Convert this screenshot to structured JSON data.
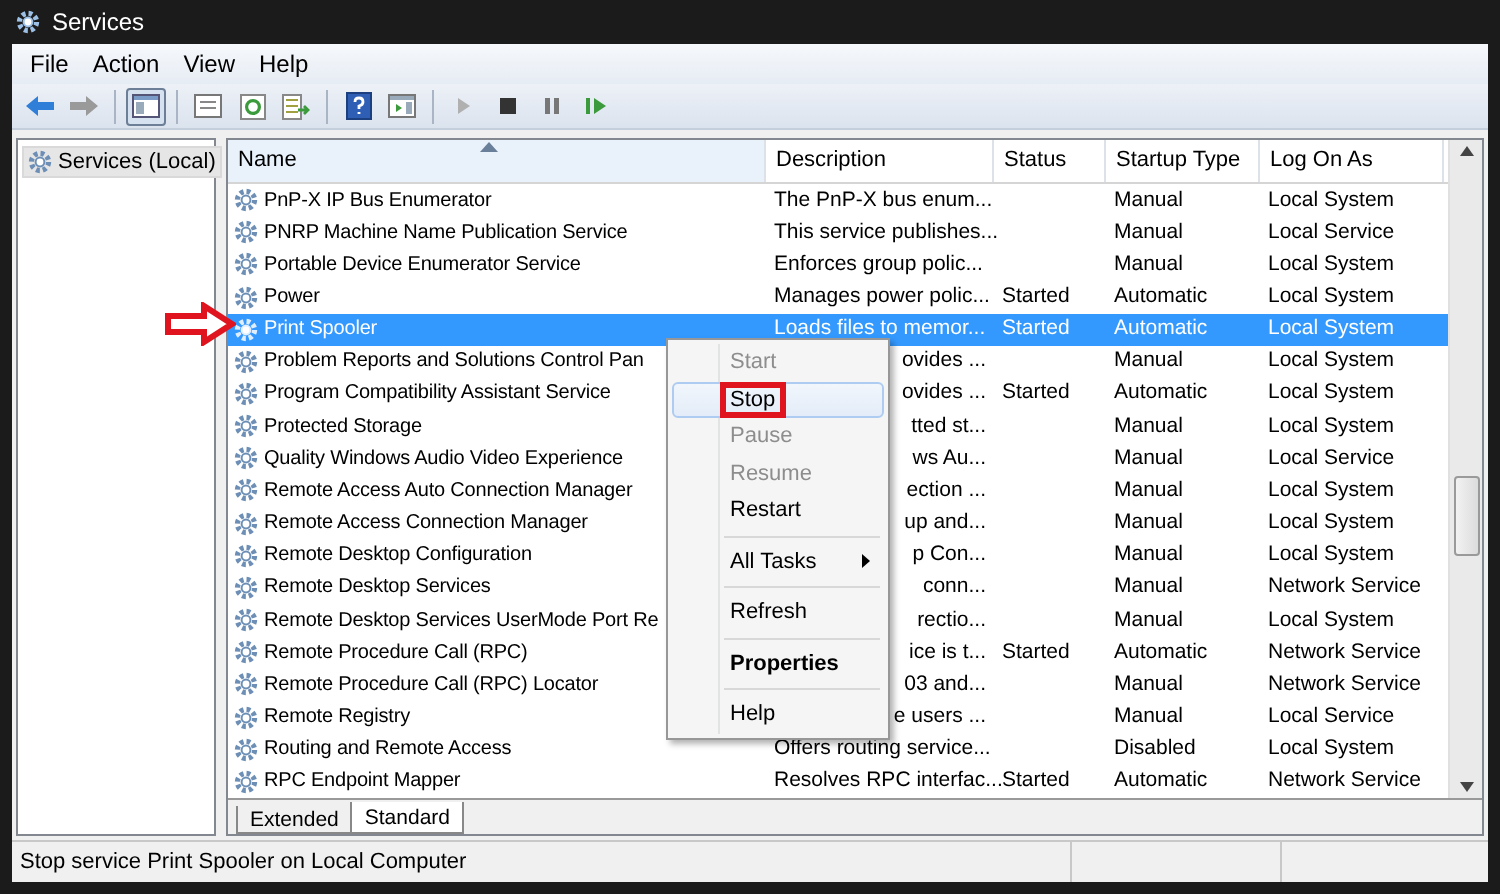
{
  "window": {
    "title": "Services"
  },
  "menu_bar": [
    "File",
    "Action",
    "View",
    "Help"
  ],
  "toolbar": [
    {
      "kind": "back"
    },
    {
      "kind": "forward"
    },
    {
      "kind": "sep"
    },
    {
      "kind": "tree",
      "selected": true
    },
    {
      "kind": "sep"
    },
    {
      "kind": "sheet"
    },
    {
      "kind": "refresh"
    },
    {
      "kind": "export"
    },
    {
      "kind": "sep"
    },
    {
      "kind": "help"
    },
    {
      "kind": "pane"
    },
    {
      "kind": "sep"
    },
    {
      "kind": "play"
    },
    {
      "kind": "stop"
    },
    {
      "kind": "pause"
    },
    {
      "kind": "resume"
    }
  ],
  "tree": {
    "label": "Services (Local)"
  },
  "table": {
    "columns": [
      "Name",
      "Description",
      "Status",
      "Startup Type",
      "Log On As"
    ],
    "rows": [
      {
        "name": "PnP-X IP Bus Enumerator",
        "description": "The PnP-X bus enum...",
        "status": "",
        "startup": "Manual",
        "logon": "Local System",
        "selected": false,
        "covered": false
      },
      {
        "name": "PNRP Machine Name Publication Service",
        "description": "This service publishes...",
        "status": "",
        "startup": "Manual",
        "logon": "Local Service",
        "selected": false,
        "covered": false
      },
      {
        "name": "Portable Device Enumerator Service",
        "description": "Enforces group polic...",
        "status": "",
        "startup": "Manual",
        "logon": "Local System",
        "selected": false,
        "covered": false
      },
      {
        "name": "Power",
        "description": "Manages power polic...",
        "status": "Started",
        "startup": "Automatic",
        "logon": "Local System",
        "selected": false,
        "covered": false
      },
      {
        "name": "Print Spooler",
        "description": "Loads files to memor...",
        "status": "Started",
        "startup": "Automatic",
        "logon": "Local System",
        "selected": true,
        "covered": false
      },
      {
        "name": "Problem Reports and Solutions Control Pan",
        "description": "ovides ...",
        "status": "",
        "startup": "Manual",
        "logon": "Local System",
        "selected": false,
        "covered": true
      },
      {
        "name": "Program Compatibility Assistant Service",
        "description": "ovides ...",
        "status": "Started",
        "startup": "Automatic",
        "logon": "Local System",
        "selected": false,
        "covered": true
      },
      {
        "name": "Protected Storage",
        "description": "tted st...",
        "status": "",
        "startup": "Manual",
        "logon": "Local System",
        "selected": false,
        "covered": true
      },
      {
        "name": "Quality Windows Audio Video Experience",
        "description": "ws Au...",
        "status": "",
        "startup": "Manual",
        "logon": "Local Service",
        "selected": false,
        "covered": true
      },
      {
        "name": "Remote Access Auto Connection Manager",
        "description": "ection ...",
        "status": "",
        "startup": "Manual",
        "logon": "Local System",
        "selected": false,
        "covered": true
      },
      {
        "name": "Remote Access Connection Manager",
        "description": "up and...",
        "status": "",
        "startup": "Manual",
        "logon": "Local System",
        "selected": false,
        "covered": true
      },
      {
        "name": "Remote Desktop Configuration",
        "description": "p Con...",
        "status": "",
        "startup": "Manual",
        "logon": "Local System",
        "selected": false,
        "covered": true
      },
      {
        "name": "Remote Desktop Services",
        "description": "conn...",
        "status": "",
        "startup": "Manual",
        "logon": "Network Service",
        "selected": false,
        "covered": true
      },
      {
        "name": "Remote Desktop Services UserMode Port Re",
        "description": "rectio...",
        "status": "",
        "startup": "Manual",
        "logon": "Local System",
        "selected": false,
        "covered": true
      },
      {
        "name": "Remote Procedure Call (RPC)",
        "description": "ice is t...",
        "status": "Started",
        "startup": "Automatic",
        "logon": "Network Service",
        "selected": false,
        "covered": true
      },
      {
        "name": "Remote Procedure Call (RPC) Locator",
        "description": "03 and...",
        "status": "",
        "startup": "Manual",
        "logon": "Network Service",
        "selected": false,
        "covered": true
      },
      {
        "name": "Remote Registry",
        "description": "e users ...",
        "status": "",
        "startup": "Manual",
        "logon": "Local Service",
        "selected": false,
        "covered": true
      },
      {
        "name": "Routing and Remote Access",
        "description": "Offers routing service...",
        "status": "",
        "startup": "Disabled",
        "logon": "Local System",
        "selected": false,
        "covered": false
      },
      {
        "name": "RPC Endpoint Mapper",
        "description": "Resolves RPC interfac...",
        "status": "Started",
        "startup": "Automatic",
        "logon": "Network Service",
        "selected": false,
        "covered": false
      }
    ]
  },
  "context_menu": [
    {
      "kind": "item",
      "label": "Start",
      "disabled": true,
      "selected": false
    },
    {
      "kind": "item",
      "label": "Stop",
      "disabled": false,
      "selected": true,
      "callout": true
    },
    {
      "kind": "item",
      "label": "Pause",
      "disabled": true,
      "selected": false
    },
    {
      "kind": "item",
      "label": "Resume",
      "disabled": true,
      "selected": false
    },
    {
      "kind": "item",
      "label": "Restart",
      "disabled": false,
      "selected": false
    },
    {
      "kind": "separator"
    },
    {
      "kind": "submenu",
      "label": "All Tasks",
      "disabled": false,
      "selected": false
    },
    {
      "kind": "separator"
    },
    {
      "kind": "item",
      "label": "Refresh",
      "disabled": false,
      "selected": false
    },
    {
      "kind": "separator"
    },
    {
      "kind": "item",
      "label": "Properties",
      "disabled": false,
      "selected": false,
      "bold": true
    },
    {
      "kind": "separator"
    },
    {
      "kind": "item",
      "label": "Help",
      "disabled": false,
      "selected": false
    }
  ],
  "view_tabs": [
    {
      "label": "Extended",
      "selected": false
    },
    {
      "label": "Standard",
      "selected": true
    }
  ],
  "status_bar": "Stop service Print Spooler on Local Computer"
}
